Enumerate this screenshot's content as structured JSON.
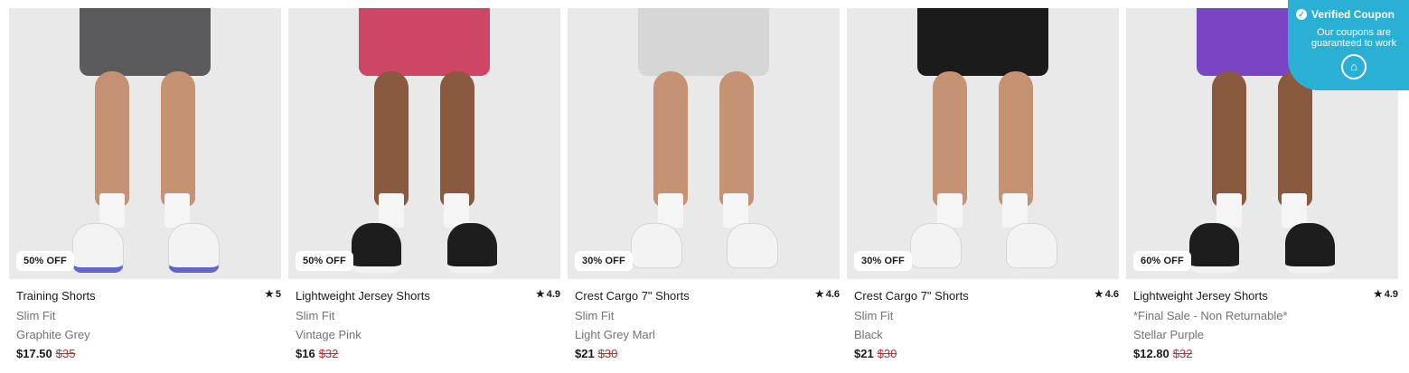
{
  "products": [
    {
      "title": "Training Shorts",
      "rating": "5",
      "subtitle": "Slim Fit",
      "color": "Graphite Grey",
      "price": "$17.50",
      "was_price": "$35",
      "badge": "50% OFF",
      "shorts_hex": "#5b5b5d",
      "shoe": "white"
    },
    {
      "title": "Lightweight Jersey Shorts",
      "rating": "4.9",
      "subtitle": "Slim Fit",
      "color": "Vintage Pink",
      "price": "$16",
      "was_price": "$32",
      "badge": "50% OFF",
      "shorts_hex": "#cf4565",
      "shoe": "black"
    },
    {
      "title": "Crest Cargo 7\" Shorts",
      "rating": "4.6",
      "subtitle": "Slim Fit",
      "color": "Light Grey Marl",
      "price": "$21",
      "was_price": "$30",
      "badge": "30% OFF",
      "shorts_hex": "#d6d6d6",
      "shoe": "white"
    },
    {
      "title": "Crest Cargo 7\" Shorts",
      "rating": "4.6",
      "subtitle": "Slim Fit",
      "color": "Black",
      "price": "$21",
      "was_price": "$30",
      "badge": "30% OFF",
      "shorts_hex": "#1b1b1b",
      "shoe": "white"
    },
    {
      "title": "Lightweight Jersey Shorts",
      "rating": "4.9",
      "subtitle": "*Final Sale - Non Returnable*",
      "color": "Stellar Purple",
      "price": "$12.80",
      "was_price": "$32",
      "badge": "60% OFF",
      "shorts_hex": "#7a45c4",
      "shoe": "black"
    }
  ],
  "coupon": {
    "title": "Verified Coupon",
    "line1": "Our coupons are",
    "line2": "guaranteed to work",
    "logo_icon": "coupon-logo-icon",
    "accent": "#2bb0d5"
  }
}
